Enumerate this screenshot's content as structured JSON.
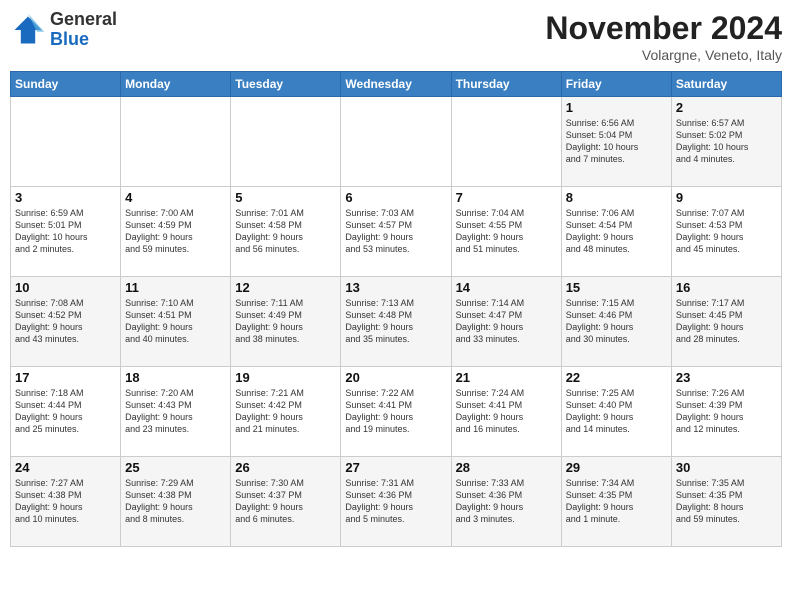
{
  "logo": {
    "general": "General",
    "blue": "Blue"
  },
  "title": "November 2024",
  "location": "Volargne, Veneto, Italy",
  "weekdays": [
    "Sunday",
    "Monday",
    "Tuesday",
    "Wednesday",
    "Thursday",
    "Friday",
    "Saturday"
  ],
  "weeks": [
    [
      {
        "day": "",
        "info": ""
      },
      {
        "day": "",
        "info": ""
      },
      {
        "day": "",
        "info": ""
      },
      {
        "day": "",
        "info": ""
      },
      {
        "day": "",
        "info": ""
      },
      {
        "day": "1",
        "info": "Sunrise: 6:56 AM\nSunset: 5:04 PM\nDaylight: 10 hours\nand 7 minutes."
      },
      {
        "day": "2",
        "info": "Sunrise: 6:57 AM\nSunset: 5:02 PM\nDaylight: 10 hours\nand 4 minutes."
      }
    ],
    [
      {
        "day": "3",
        "info": "Sunrise: 6:59 AM\nSunset: 5:01 PM\nDaylight: 10 hours\nand 2 minutes."
      },
      {
        "day": "4",
        "info": "Sunrise: 7:00 AM\nSunset: 4:59 PM\nDaylight: 9 hours\nand 59 minutes."
      },
      {
        "day": "5",
        "info": "Sunrise: 7:01 AM\nSunset: 4:58 PM\nDaylight: 9 hours\nand 56 minutes."
      },
      {
        "day": "6",
        "info": "Sunrise: 7:03 AM\nSunset: 4:57 PM\nDaylight: 9 hours\nand 53 minutes."
      },
      {
        "day": "7",
        "info": "Sunrise: 7:04 AM\nSunset: 4:55 PM\nDaylight: 9 hours\nand 51 minutes."
      },
      {
        "day": "8",
        "info": "Sunrise: 7:06 AM\nSunset: 4:54 PM\nDaylight: 9 hours\nand 48 minutes."
      },
      {
        "day": "9",
        "info": "Sunrise: 7:07 AM\nSunset: 4:53 PM\nDaylight: 9 hours\nand 45 minutes."
      }
    ],
    [
      {
        "day": "10",
        "info": "Sunrise: 7:08 AM\nSunset: 4:52 PM\nDaylight: 9 hours\nand 43 minutes."
      },
      {
        "day": "11",
        "info": "Sunrise: 7:10 AM\nSunset: 4:51 PM\nDaylight: 9 hours\nand 40 minutes."
      },
      {
        "day": "12",
        "info": "Sunrise: 7:11 AM\nSunset: 4:49 PM\nDaylight: 9 hours\nand 38 minutes."
      },
      {
        "day": "13",
        "info": "Sunrise: 7:13 AM\nSunset: 4:48 PM\nDaylight: 9 hours\nand 35 minutes."
      },
      {
        "day": "14",
        "info": "Sunrise: 7:14 AM\nSunset: 4:47 PM\nDaylight: 9 hours\nand 33 minutes."
      },
      {
        "day": "15",
        "info": "Sunrise: 7:15 AM\nSunset: 4:46 PM\nDaylight: 9 hours\nand 30 minutes."
      },
      {
        "day": "16",
        "info": "Sunrise: 7:17 AM\nSunset: 4:45 PM\nDaylight: 9 hours\nand 28 minutes."
      }
    ],
    [
      {
        "day": "17",
        "info": "Sunrise: 7:18 AM\nSunset: 4:44 PM\nDaylight: 9 hours\nand 25 minutes."
      },
      {
        "day": "18",
        "info": "Sunrise: 7:20 AM\nSunset: 4:43 PM\nDaylight: 9 hours\nand 23 minutes."
      },
      {
        "day": "19",
        "info": "Sunrise: 7:21 AM\nSunset: 4:42 PM\nDaylight: 9 hours\nand 21 minutes."
      },
      {
        "day": "20",
        "info": "Sunrise: 7:22 AM\nSunset: 4:41 PM\nDaylight: 9 hours\nand 19 minutes."
      },
      {
        "day": "21",
        "info": "Sunrise: 7:24 AM\nSunset: 4:41 PM\nDaylight: 9 hours\nand 16 minutes."
      },
      {
        "day": "22",
        "info": "Sunrise: 7:25 AM\nSunset: 4:40 PM\nDaylight: 9 hours\nand 14 minutes."
      },
      {
        "day": "23",
        "info": "Sunrise: 7:26 AM\nSunset: 4:39 PM\nDaylight: 9 hours\nand 12 minutes."
      }
    ],
    [
      {
        "day": "24",
        "info": "Sunrise: 7:27 AM\nSunset: 4:38 PM\nDaylight: 9 hours\nand 10 minutes."
      },
      {
        "day": "25",
        "info": "Sunrise: 7:29 AM\nSunset: 4:38 PM\nDaylight: 9 hours\nand 8 minutes."
      },
      {
        "day": "26",
        "info": "Sunrise: 7:30 AM\nSunset: 4:37 PM\nDaylight: 9 hours\nand 6 minutes."
      },
      {
        "day": "27",
        "info": "Sunrise: 7:31 AM\nSunset: 4:36 PM\nDaylight: 9 hours\nand 5 minutes."
      },
      {
        "day": "28",
        "info": "Sunrise: 7:33 AM\nSunset: 4:36 PM\nDaylight: 9 hours\nand 3 minutes."
      },
      {
        "day": "29",
        "info": "Sunrise: 7:34 AM\nSunset: 4:35 PM\nDaylight: 9 hours\nand 1 minute."
      },
      {
        "day": "30",
        "info": "Sunrise: 7:35 AM\nSunset: 4:35 PM\nDaylight: 8 hours\nand 59 minutes."
      }
    ]
  ]
}
